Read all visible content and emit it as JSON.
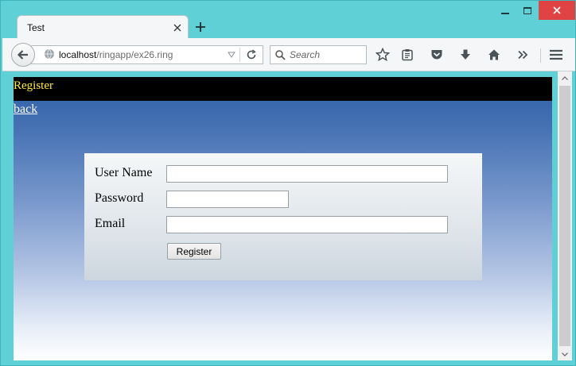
{
  "browser": {
    "tab_title": "Test",
    "url_host": "localhost",
    "url_path": "/ringapp/ex26.ring",
    "search_placeholder": "Search"
  },
  "page": {
    "header_title": "Register",
    "back_link": "back",
    "form": {
      "username_label": "User Name",
      "password_label": "Password",
      "email_label": "Email",
      "username_value": "",
      "password_value": "",
      "email_value": "",
      "submit_label": "Register"
    }
  },
  "colors": {
    "window_frame": "#5fd0d6",
    "close_button": "#e04343",
    "header_bar": "#000000",
    "header_text": "#ffeb3b",
    "gradient_top": "#2d5da4"
  }
}
